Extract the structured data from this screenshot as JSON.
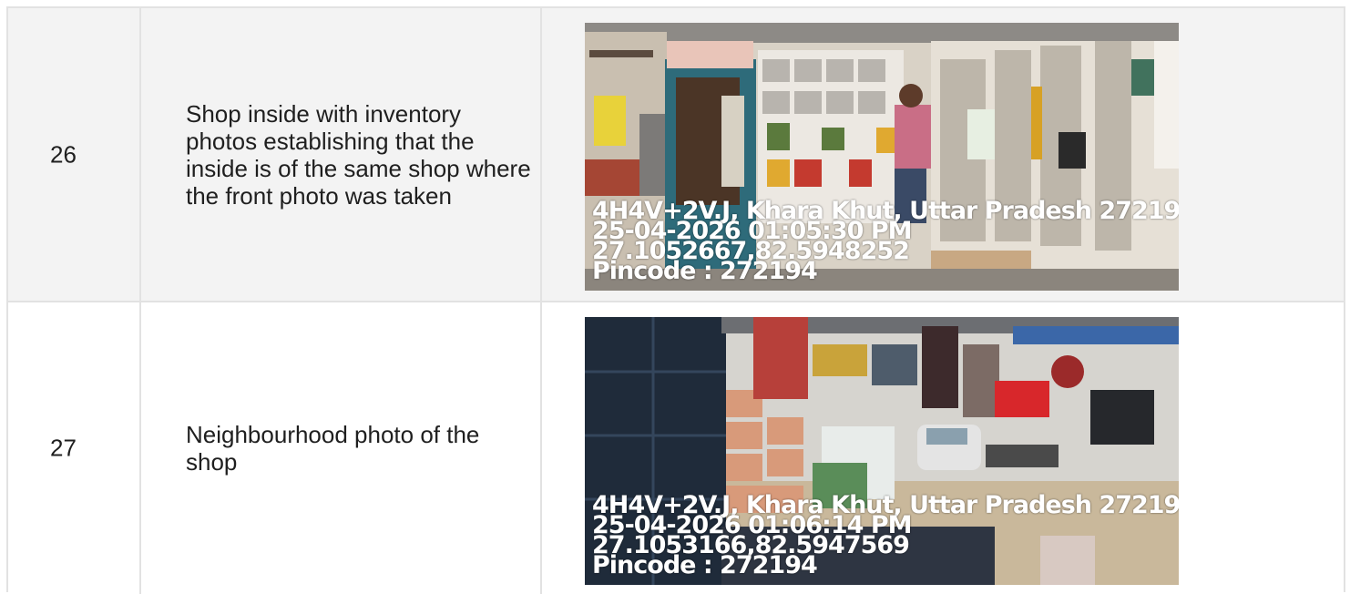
{
  "rows": [
    {
      "number": "26",
      "description": "Shop inside with inventory photos establishing that the inside is of the same shop where the front photo was taken",
      "photo": {
        "subject": "shop-interior-photo",
        "stamp": [
          "4H4V+2V.J, Khara Khut, Uttar Pradesh 27219",
          "25-04-2026 01:05:30 PM",
          "27.1052667,82.5948252",
          "Pincode : 272194"
        ]
      }
    },
    {
      "number": "27",
      "description": "Neighbourhood photo of the shop",
      "photo": {
        "subject": "neighbourhood-photo",
        "stamp": [
          "4H4V+2V.J, Khara Khut, Uttar Pradesh 27219",
          "25-04-2026 01:06:14 PM",
          "27.1053166,82.5947569",
          "Pincode : 272194"
        ]
      }
    }
  ],
  "colors": {
    "row_alt_bg": "#f3f3f3",
    "border": "#e2e2e2",
    "text": "#1f1f1f",
    "stamp_text": "#ffffff"
  }
}
